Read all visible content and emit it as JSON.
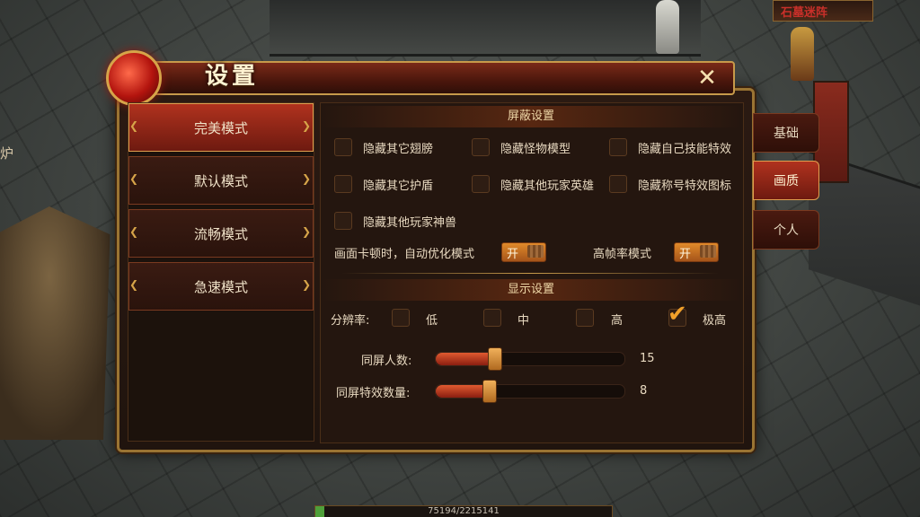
{
  "dialog": {
    "title": "设置",
    "close_label": "✕"
  },
  "modes": [
    {
      "label": "完美模式",
      "active": true
    },
    {
      "label": "默认模式",
      "active": false
    },
    {
      "label": "流畅模式",
      "active": false
    },
    {
      "label": "急速模式",
      "active": false
    }
  ],
  "side_tabs": [
    {
      "label": "基础",
      "active": false
    },
    {
      "label": "画质",
      "active": true
    },
    {
      "label": "个人",
      "active": false
    }
  ],
  "shield": {
    "heading": "屏蔽设置",
    "options": [
      {
        "label": "隐藏其它翅膀",
        "checked": false
      },
      {
        "label": "隐藏怪物模型",
        "checked": false
      },
      {
        "label": "隐藏自己技能特效",
        "checked": false
      },
      {
        "label": "隐藏其它护盾",
        "checked": false
      },
      {
        "label": "隐藏其他玩家英雄",
        "checked": false
      },
      {
        "label": "隐藏称号特效图标",
        "checked": false
      },
      {
        "label": "隐藏其他玩家神兽",
        "checked": false
      }
    ],
    "auto_optimize_label": "画面卡顿时，自动优化模式",
    "auto_optimize_state": "开",
    "high_fps_label": "高帧率模式",
    "high_fps_state": "开"
  },
  "display": {
    "heading": "显示设置",
    "resolution_label": "分辨率:",
    "resolutions": [
      {
        "label": "低",
        "checked": false
      },
      {
        "label": "中",
        "checked": false
      },
      {
        "label": "高",
        "checked": false
      },
      {
        "label": "极高",
        "checked": true
      }
    ],
    "players_label": "同屏人数:",
    "players_value": "15",
    "players_fraction": 0.31,
    "effects_label": "同屏特效数量:",
    "effects_value": "8",
    "effects_fraction": 0.28
  },
  "scene": {
    "exp_text": "75194/2215141",
    "sign_text": "石墓迷阵",
    "stove_text": "炉"
  },
  "colors": {
    "accent_gold": "#c79a4a",
    "active_red": "#b0321e",
    "toggle_orange": "#e08a2a"
  }
}
